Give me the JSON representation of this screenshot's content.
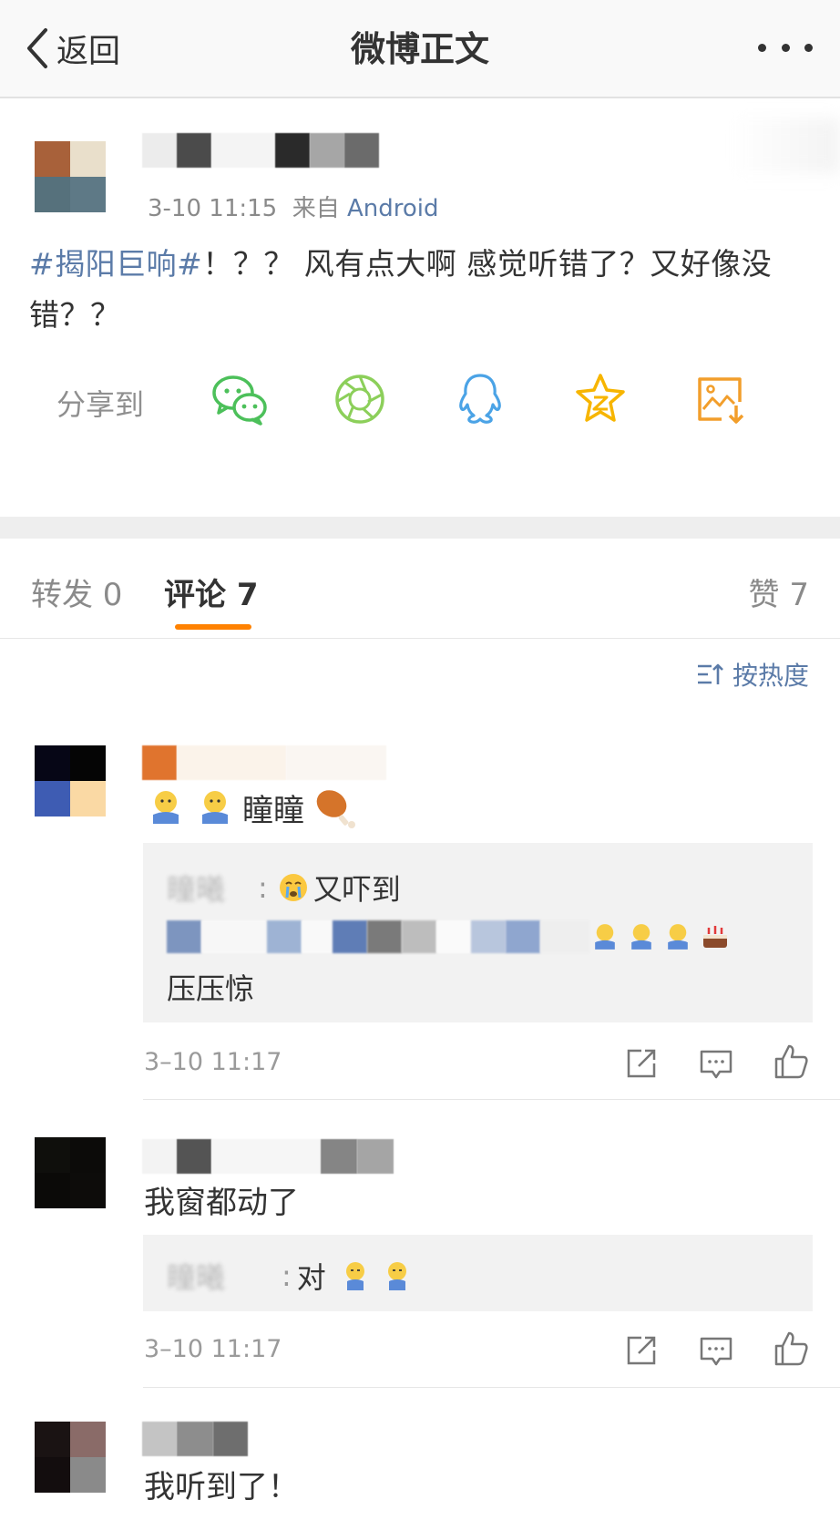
{
  "nav": {
    "back_label": "返回",
    "title": "微博正文"
  },
  "post": {
    "time": "3-10 11:15",
    "source_prefix": "来自",
    "source": "Android",
    "topic": "#揭阳巨响#",
    "text": "！？？ 风有点大啊 感觉听错了？又好像没错？？",
    "share_label": "分享到",
    "share_icons": [
      "wechat-icon",
      "moments-icon",
      "qq-icon",
      "qzone-icon",
      "save-image-icon"
    ]
  },
  "tabs": {
    "repost": "转发 0",
    "comment": "评论 7",
    "like": "赞 7"
  },
  "sort_label": "按热度",
  "comments": [
    {
      "text": "瞳瞳",
      "reply_1_blur": "瞳曦",
      "reply_1_text": "又吓到",
      "reply_2_text": "压压惊",
      "time": "3–10 11:17"
    },
    {
      "text": "我窗都动了",
      "reply_1_blur": "瞳曦",
      "reply_1_text": "对",
      "time": "3–10 11:17"
    },
    {
      "text": "我听到了！"
    }
  ],
  "colors": {
    "link": "#5b7ba8",
    "accent": "#ff8200",
    "wechat": "#4cc05a",
    "qq": "#4ba3e6",
    "qzone": "#f7b500",
    "save": "#f29e2b"
  }
}
